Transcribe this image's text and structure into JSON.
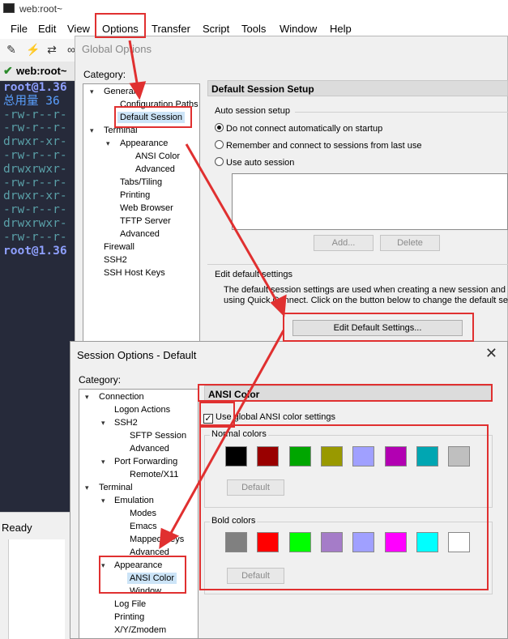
{
  "app": {
    "title": "web:root~",
    "menu": [
      "File",
      "Edit",
      "View",
      "Options",
      "Transfer",
      "Script",
      "Tools",
      "Window",
      "Help"
    ],
    "tab_label": "web:root~",
    "status": "Ready"
  },
  "terminal": {
    "lines": [
      {
        "text": "root@1.36",
        "color": "#8fa0ff",
        "bold": true
      },
      {
        "text": "总用量 36",
        "color": "#5aa0ff",
        "bold": false
      },
      {
        "text": "-rw-r--r-",
        "color": "#5aa0a8",
        "bold": false
      },
      {
        "text": "-rw-r--r-",
        "color": "#5aa0a8",
        "bold": false
      },
      {
        "text": "drwxr-xr-",
        "color": "#5aa0a8",
        "bold": false
      },
      {
        "text": "-rw-r--r-",
        "color": "#5aa0a8",
        "bold": false
      },
      {
        "text": "drwxrwxr-",
        "color": "#5aa0a8",
        "bold": false
      },
      {
        "text": "-rw-r--r-",
        "color": "#5aa0a8",
        "bold": false
      },
      {
        "text": "drwxr-xr-",
        "color": "#5aa0a8",
        "bold": false
      },
      {
        "text": "-rw-r--r-",
        "color": "#5aa0a8",
        "bold": false
      },
      {
        "text": "drwxrwxr-",
        "color": "#5aa0a8",
        "bold": false
      },
      {
        "text": "-rw-r--r-",
        "color": "#5aa0a8",
        "bold": false
      },
      {
        "text": "root@1.36",
        "color": "#8fa0ff",
        "bold": true
      }
    ]
  },
  "global_options": {
    "title": "Global Options",
    "category_label": "Category:",
    "tree": {
      "general": "General",
      "configuration_paths": "Configuration Paths",
      "default_session": "Default Session",
      "terminal": "Terminal",
      "appearance": "Appearance",
      "ansi_color": "ANSI Color",
      "advanced_1": "Advanced",
      "tabs_tiling": "Tabs/Tiling",
      "printing": "Printing",
      "web_browser": "Web Browser",
      "tftp_server": "TFTP Server",
      "advanced_2": "Advanced",
      "firewall": "Firewall",
      "ssh2": "SSH2",
      "ssh_host_keys": "SSH Host Keys"
    },
    "header": "Default Session Setup",
    "auto_group": "Auto session setup",
    "radio_no_connect": "Do not connect automatically on startup",
    "radio_remember": "Remember and connect to sessions from last use",
    "radio_auto": "Use auto session",
    "add_button": "Add...",
    "delete_button": "Delete",
    "edit_group": "Edit default settings",
    "desc_line1": "The default session settings are used when creating a new session and w",
    "desc_line2": "using Quick Connect.  Click on the button below to change the default se",
    "edit_button": "Edit Default Settings..."
  },
  "session_options": {
    "title": "Session Options - Default",
    "close": "✕",
    "category_label": "Category:",
    "tree": {
      "connection": "Connection",
      "logon_actions": "Logon Actions",
      "ssh2": "SSH2",
      "sftp_session": "SFTP Session",
      "advanced_1": "Advanced",
      "port_forwarding": "Port Forwarding",
      "remote_x11": "Remote/X11",
      "terminal": "Terminal",
      "emulation": "Emulation",
      "modes": "Modes",
      "emacs": "Emacs",
      "mapped_keys": "Mapped Keys",
      "advanced_2": "Advanced",
      "appearance": "Appearance",
      "ansi_color": "ANSI Color",
      "window": "Window",
      "log_file": "Log File",
      "printing": "Printing",
      "xyzmodem": "X/Y/Zmodem"
    },
    "header": "ANSI Color",
    "use_global": "Use global ANSI color settings",
    "normal_label": "Normal colors",
    "normal_colors": [
      "#000000",
      "#990000",
      "#00a600",
      "#999900",
      "#a0a0ff",
      "#b200b2",
      "#00a6b2",
      "#bfbfbf"
    ],
    "bold_label": "Bold colors",
    "bold_colors": [
      "#808080",
      "#ff0000",
      "#00ff00",
      "#a57cc8",
      "#a0a0ff",
      "#ff00ff",
      "#00ffff",
      "#ffffff"
    ],
    "default_button": "Default"
  },
  "colors": {
    "annotation": "#e03030",
    "terminal_bg": "#262a3a",
    "selection": "#cce4f7"
  }
}
